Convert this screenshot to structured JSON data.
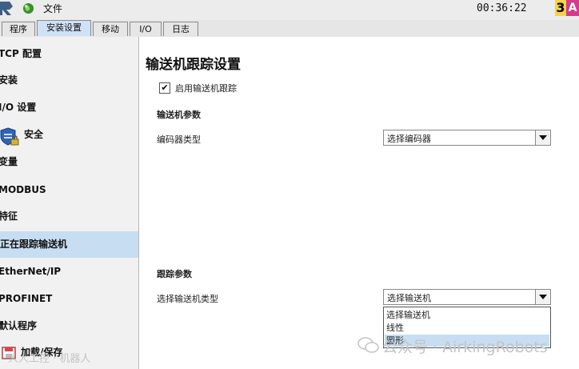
{
  "topbar": {
    "file_menu": "文件",
    "clock": "00:36:22",
    "badge_left": "3",
    "badge_right": "A"
  },
  "tabs": [
    {
      "label": "程序"
    },
    {
      "label": "安装设置"
    },
    {
      "label": "移动"
    },
    {
      "label": "I/O"
    },
    {
      "label": "日志"
    }
  ],
  "active_tab": "安装设置",
  "sidebar": {
    "items": [
      {
        "label": "TCP 配置"
      },
      {
        "label": "安装"
      },
      {
        "label": "I/O 设置"
      },
      {
        "label": "安全"
      },
      {
        "label": "变量"
      },
      {
        "label": "MODBUS"
      },
      {
        "label": "特征"
      },
      {
        "label": "正在跟踪输送机"
      },
      {
        "label": "EtherNet/IP"
      },
      {
        "label": "PROFINET"
      },
      {
        "label": "默认程序"
      },
      {
        "label": "加载/保存"
      }
    ],
    "active": "正在跟踪输送机"
  },
  "main": {
    "title": "输送机跟踪设置",
    "enable_checkbox": {
      "label": "启用输送机跟踪",
      "checked": true,
      "mark": "✔"
    },
    "conveyor_params": {
      "heading": "输送机参数",
      "encoder_type_label": "编码器类型",
      "encoder_type_value": "选择编码器"
    },
    "tracking_params": {
      "heading": "跟踪参数",
      "conveyor_type_label": "选择输送机类型",
      "conveyor_type_value": "选择输送机",
      "options": [
        "选择输送机",
        "线性",
        "圆形"
      ],
      "highlighted_option": "圆形"
    }
  },
  "watermark": {
    "right": "公众号 · AirkingRobots",
    "left": "人人工控 · 机器人"
  },
  "colors": {
    "active_blue": "#c7ddf2",
    "tab_active": "#cfe1f5",
    "badge_yellow": "#f6d24a",
    "badge_pink": "#d33b8e"
  }
}
